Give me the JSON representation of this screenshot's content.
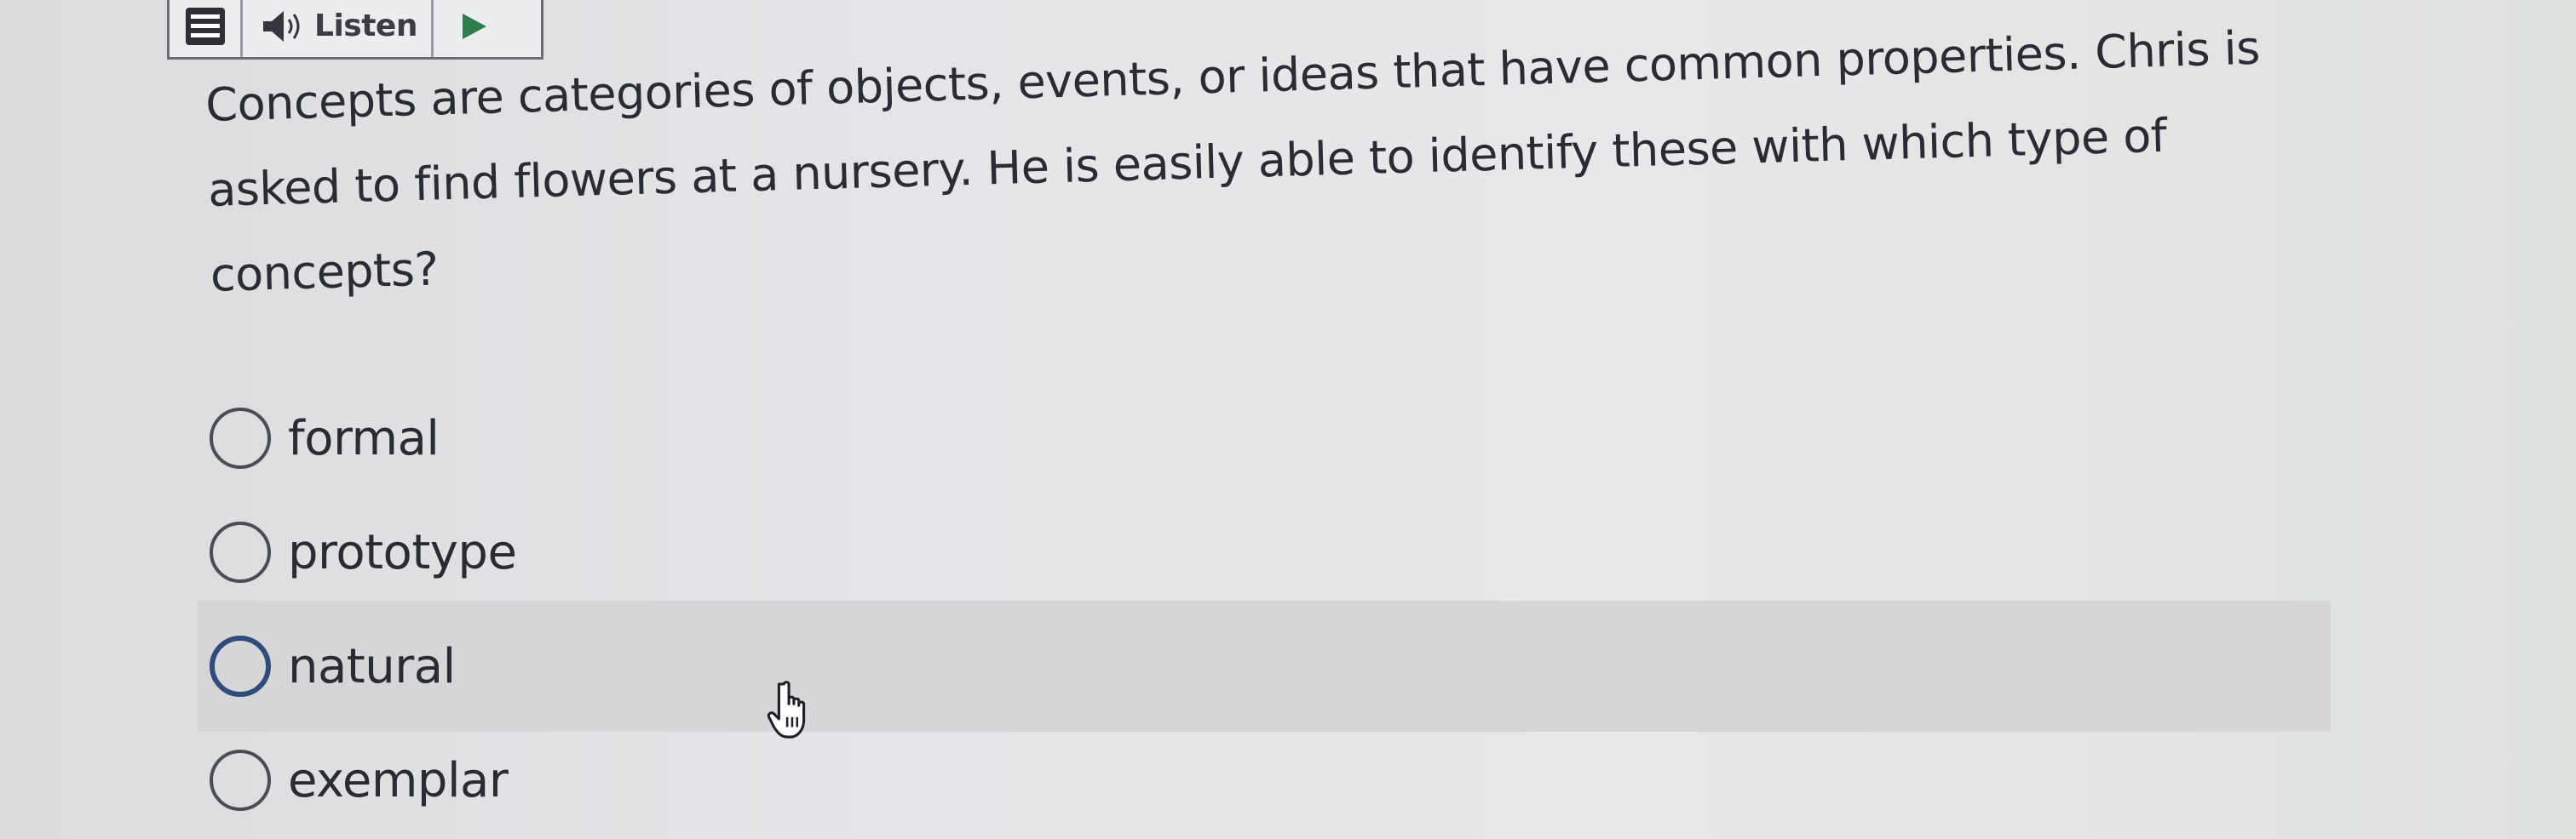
{
  "toolbar": {
    "menu_icon": "hamburger-menu-icon",
    "speaker_icon": "speaker-icon",
    "listen_label": "Listen",
    "play_icon": "play-icon"
  },
  "question": {
    "text": "Concepts are categories of objects, events, or ideas that have common properties. Chris is asked to find flowers at a nursery. He is easily able to identify these with which type of concepts?"
  },
  "options": [
    {
      "label": "formal",
      "selected": false,
      "hovered": false
    },
    {
      "label": "prototype",
      "selected": false,
      "hovered": false
    },
    {
      "label": "natural",
      "selected": false,
      "hovered": true
    },
    {
      "label": "exemplar",
      "selected": false,
      "hovered": false
    }
  ],
  "colors": {
    "hover_row": "#d6d6d8",
    "hover_radio_border": "#2f4c7a",
    "play_icon": "#2e7d4f"
  },
  "cursor": {
    "icon": "hand-pointer-cursor-icon"
  }
}
